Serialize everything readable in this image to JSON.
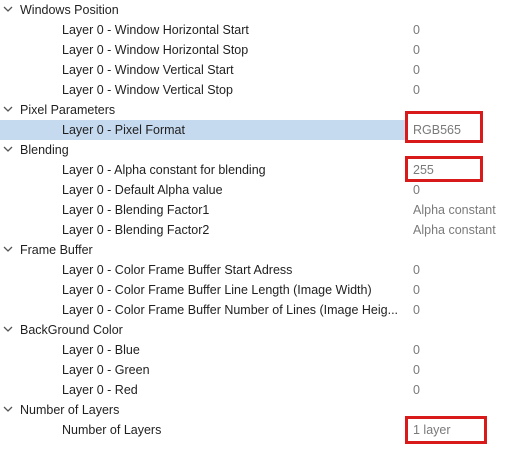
{
  "colors": {
    "selected_row": "#c5d9ef",
    "highlight_border": "#d81a1a",
    "text": "#1f1f1f"
  },
  "icons": {
    "expanded": "chevron-down-icon"
  },
  "categories": {
    "windows_position": {
      "label": "Windows Position",
      "props": [
        {
          "name": "Layer 0 - Window Horizontal Start",
          "value": "0"
        },
        {
          "name": "Layer 0 - Window Horizontal Stop",
          "value": "0"
        },
        {
          "name": "Layer 0 - Window Vertical Start",
          "value": "0"
        },
        {
          "name": "Layer 0 - Window Vertical Stop",
          "value": "0"
        }
      ]
    },
    "pixel_parameters": {
      "label": "Pixel Parameters",
      "props": [
        {
          "name": "Layer 0 - Pixel Format",
          "value": "RGB565"
        }
      ]
    },
    "blending": {
      "label": "Blending",
      "props": [
        {
          "name": "Layer 0 - Alpha constant for blending",
          "value": "255"
        },
        {
          "name": "Layer 0 - Default Alpha value",
          "value": "0"
        },
        {
          "name": "Layer 0 - Blending Factor1",
          "value": "Alpha constant"
        },
        {
          "name": "Layer 0 - Blending Factor2",
          "value": "Alpha constant"
        }
      ]
    },
    "frame_buffer": {
      "label": "Frame Buffer",
      "props": [
        {
          "name": "Layer 0 - Color Frame Buffer Start Adress",
          "value": "0"
        },
        {
          "name": "Layer 0 - Color Frame Buffer Line Length (Image Width)",
          "value": "0"
        },
        {
          "name": "Layer 0 - Color Frame Buffer Number of Lines (Image Heig...",
          "value": "0"
        }
      ]
    },
    "background_color": {
      "label": "BackGround Color",
      "props": [
        {
          "name": "Layer 0 - Blue",
          "value": "0"
        },
        {
          "name": "Layer 0 - Green",
          "value": "0"
        },
        {
          "name": "Layer 0 - Red",
          "value": "0"
        }
      ]
    },
    "number_of_layers": {
      "label": "Number of Layers",
      "props": [
        {
          "name": "Number of Layers",
          "value": "1 layer"
        }
      ]
    }
  }
}
